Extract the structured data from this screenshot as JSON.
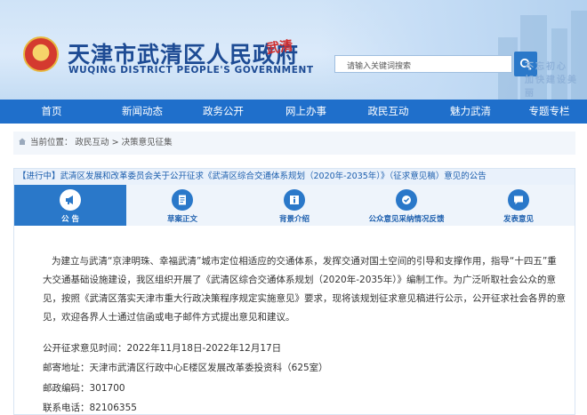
{
  "header": {
    "site_title": "天津市武清区人民政府",
    "site_subtitle": "WUQING DISTRICT PEOPLE'S GOVERNMENT",
    "logo_text": "武清",
    "search_placeholder": "请输入关键词搜索",
    "slogan_line1": "不忘初心",
    "slogan_line2": "加快建设美丽"
  },
  "nav": {
    "items": [
      "首页",
      "新闻动态",
      "政务公开",
      "网上办事",
      "政民互动",
      "魅力武清",
      "专题专栏"
    ]
  },
  "breadcrumb": {
    "prefix": "当前位置：",
    "level1": "政民互动",
    "separator": ">",
    "level2": "决策意见征集"
  },
  "notice": {
    "title": "【进行中】武清区发展和改革委员会关于公开征求《武清区综合交通体系规划（2020年-2035年）》（征求意见稿）意见的公告",
    "tabs": [
      {
        "label": "公 告",
        "icon": "megaphone-icon"
      },
      {
        "label": "草案正文",
        "icon": "document-icon"
      },
      {
        "label": "背景介绍",
        "icon": "info-icon"
      },
      {
        "label": "公众意见采纳情况反馈",
        "icon": "feedback-icon"
      },
      {
        "label": "发表意见",
        "icon": "comment-icon"
      }
    ]
  },
  "content": {
    "paragraph": "为建立与武清“京津明珠、幸福武清”城市定位相适应的交通体系，发挥交通对国土空间的引导和支撑作用，指导“十四五”重大交通基础设施建设，我区组织开展了《武清区综合交通体系规划（2020年-2035年）》编制工作。为广泛听取社会公众的意见，按照《武清区落实天津市重大行政决策程序规定实施意见》要求，现将该规划征求意见稿进行公示，公开征求社会各界的意见，欢迎各界人士通过信函或电子邮件方式提出意见和建议。",
    "period_label": "公开征求意见时间：",
    "period_value": "2022年11月18日-2022年12月17日",
    "address_label": "邮寄地址：",
    "address_value": "天津市武清区行政中心E楼区发展改革委投资科（625室）",
    "postcode_label": "邮政编码：",
    "postcode_value": "301700",
    "phone_label": "联系电话：",
    "phone_value": "82106355"
  }
}
